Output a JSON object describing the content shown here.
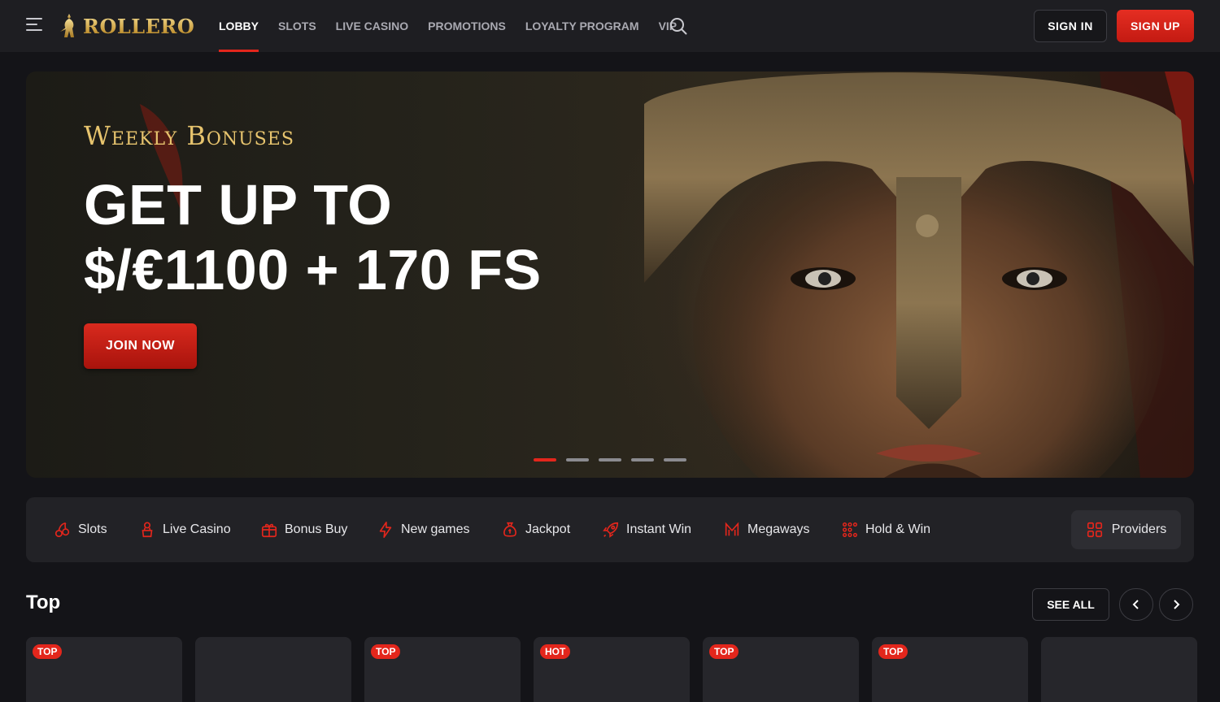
{
  "brand": {
    "name": "ROLLERO",
    "accent": "#e3261c",
    "gold": "#e7c46e"
  },
  "nav": {
    "items": [
      {
        "label": "LOBBY",
        "active": true
      },
      {
        "label": "SLOTS"
      },
      {
        "label": "LIVE CASINO"
      },
      {
        "label": "PROMOTIONS"
      },
      {
        "label": "LOYALTY PROGRAM"
      },
      {
        "label": "VIP"
      }
    ],
    "search_icon": "search-icon",
    "signin_label": "SIGN IN",
    "signup_label": "SIGN UP"
  },
  "hero": {
    "subtitle": "Weekly Bonuses",
    "title_line1": "GET UP TO",
    "title_line2": "$/€1100 + 170 FS",
    "cta": "JOIN NOW",
    "slides": 5,
    "active_slide": 1
  },
  "categories": [
    {
      "label": "Slots",
      "icon": "cherries-icon"
    },
    {
      "label": "Live Casino",
      "icon": "dealer-icon"
    },
    {
      "label": "Bonus Buy",
      "icon": "gift-coin-icon"
    },
    {
      "label": "New games",
      "icon": "lightning-icon"
    },
    {
      "label": "Jackpot",
      "icon": "money-bag-icon"
    },
    {
      "label": "Instant Win",
      "icon": "rocket-icon"
    },
    {
      "label": "Megaways",
      "icon": "megaways-icon"
    },
    {
      "label": "Hold & Win",
      "icon": "grid-dots-icon"
    }
  ],
  "providers_label": "Providers",
  "section": {
    "title": "Top",
    "see_all": "SEE ALL"
  },
  "cards": [
    {
      "badge": "TOP"
    },
    {
      "badge": ""
    },
    {
      "badge": "TOP"
    },
    {
      "badge": "HOT"
    },
    {
      "badge": "TOP"
    },
    {
      "badge": "TOP"
    },
    {
      "badge": ""
    }
  ]
}
